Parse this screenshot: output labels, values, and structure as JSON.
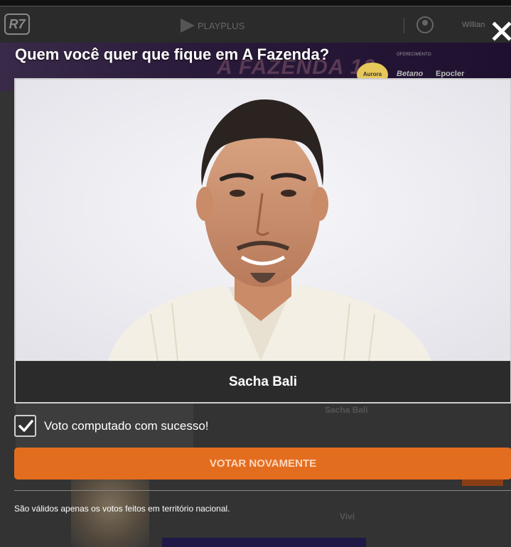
{
  "header": {
    "logo": "R7",
    "service": "PLAYPLUS",
    "user_name": "Willian"
  },
  "banner": {
    "title": "A FAZENDA 16",
    "sponsor_label": "OFERECIMENTO:",
    "brands": [
      "Aurora",
      "Betano",
      "Epocler"
    ]
  },
  "modal": {
    "title": "Quem você quer que fique em A Fazenda?",
    "candidate_name": "Sacha Bali",
    "success_message": "Voto computado com sucesso!",
    "vote_again_label": "VOTAR NOVAMENTE",
    "disclaimer": "São válidos apenas os votos feitos em território nacional.",
    "checkbox_checked": true
  },
  "background_list": {
    "names": [
      "Sacha Bali",
      "Vivi"
    ]
  },
  "colors": {
    "accent": "#e36d1f",
    "background": "#333333",
    "card_bg": "#2b2b2b"
  }
}
